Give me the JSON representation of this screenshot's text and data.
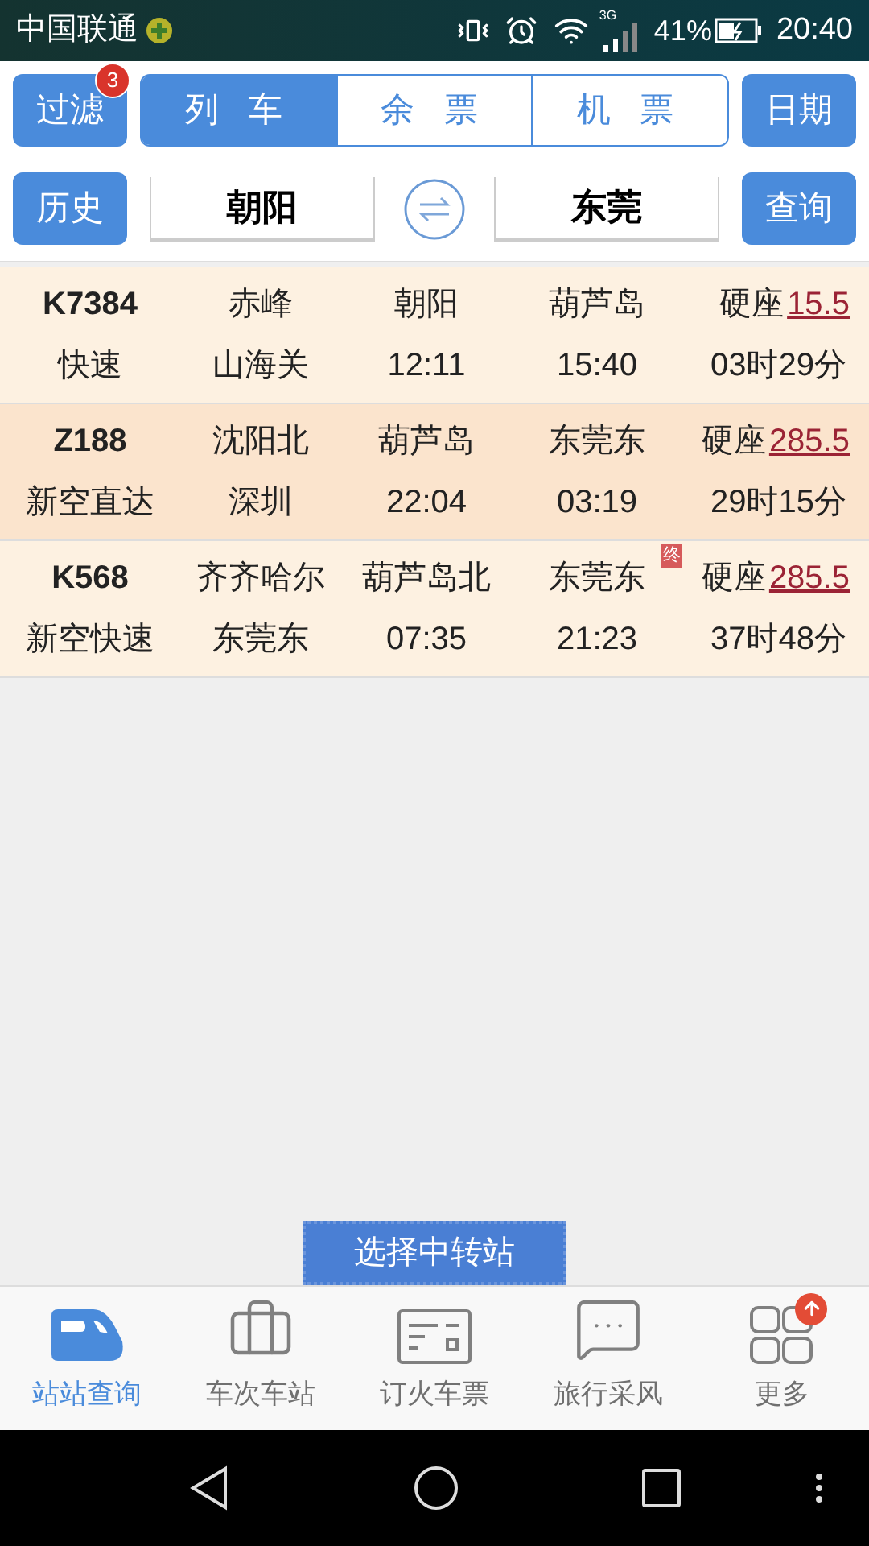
{
  "status_bar": {
    "carrier": "中国联通",
    "network": "3G",
    "battery": "41%",
    "time": "20:40"
  },
  "toolbar": {
    "filter": {
      "label": "过滤",
      "badge": "3"
    },
    "tabs": [
      {
        "label": "列 车",
        "selected": true
      },
      {
        "label": "余 票",
        "selected": false
      },
      {
        "label": "机 票",
        "selected": false
      }
    ],
    "date_button": "日期"
  },
  "route": {
    "history_button": "历史",
    "from": "朝阳",
    "to": "东莞",
    "query_button": "查询"
  },
  "trains": [
    {
      "number": "K7384",
      "type": "快速",
      "origin": "赤峰",
      "terminus": "山海关",
      "depart_station": "朝阳",
      "depart_time": "12:11",
      "arrive_station": "葫芦岛",
      "arrive_time": "15:40",
      "seat": "硬座",
      "price": "15.5",
      "duration": "03时29分",
      "selected": false
    },
    {
      "number": "Z188",
      "type": "新空直达",
      "origin": "沈阳北",
      "terminus": "深圳",
      "depart_station": "葫芦岛",
      "depart_time": "22:04",
      "arrive_station": "东莞东",
      "arrive_time": "03:19",
      "seat": "硬座",
      "price": "285.5",
      "duration": "29时15分",
      "selected": true
    },
    {
      "number": "K568",
      "type": "新空快速",
      "origin": "齐齐哈尔",
      "terminus": "东莞东",
      "depart_station": "葫芦岛北",
      "depart_time": "07:35",
      "arrive_station": "东莞东",
      "arrive_badge": "终",
      "arrive_time": "21:23",
      "seat": "硬座",
      "price": "285.5",
      "duration": "37时48分",
      "selected": false
    }
  ],
  "transfer_button": "选择中转站",
  "bottom_nav": [
    {
      "kind": "train",
      "label": "站站查询",
      "selected": true,
      "has_update": false
    },
    {
      "kind": "briefcase",
      "label": "车次车站",
      "selected": false,
      "has_update": false
    },
    {
      "kind": "ticket",
      "label": "订火车票",
      "selected": false,
      "has_update": false
    },
    {
      "kind": "chat",
      "label": "旅行采风",
      "selected": false,
      "has_update": false
    },
    {
      "kind": "grid",
      "label": "更多",
      "selected": false,
      "has_update": true
    }
  ]
}
